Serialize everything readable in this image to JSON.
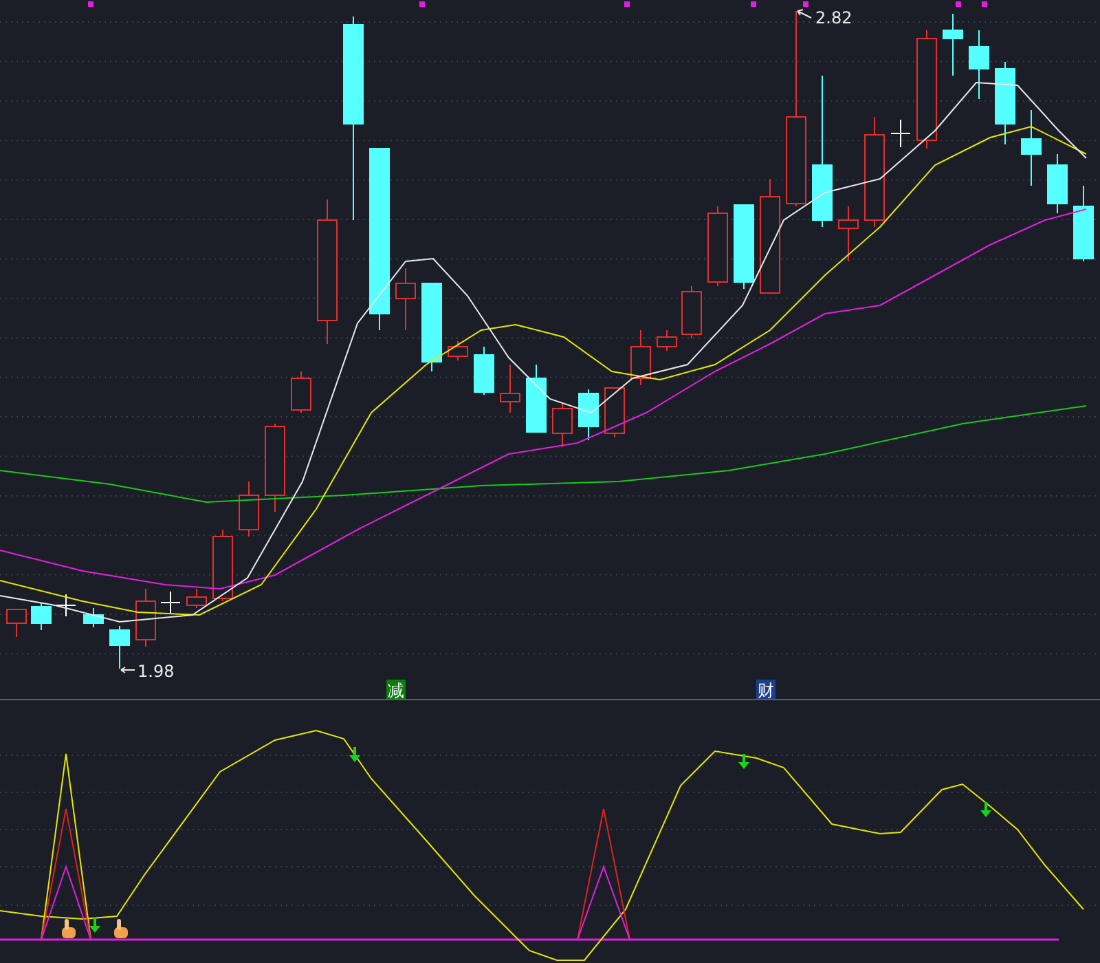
{
  "price_chart": {
    "high_label": "2.82",
    "low_label": "1.98",
    "signals": [
      {
        "label": "减",
        "color": "#0a7d0a"
      },
      {
        "label": "财",
        "color": "#1c3f8c"
      }
    ]
  }
}
